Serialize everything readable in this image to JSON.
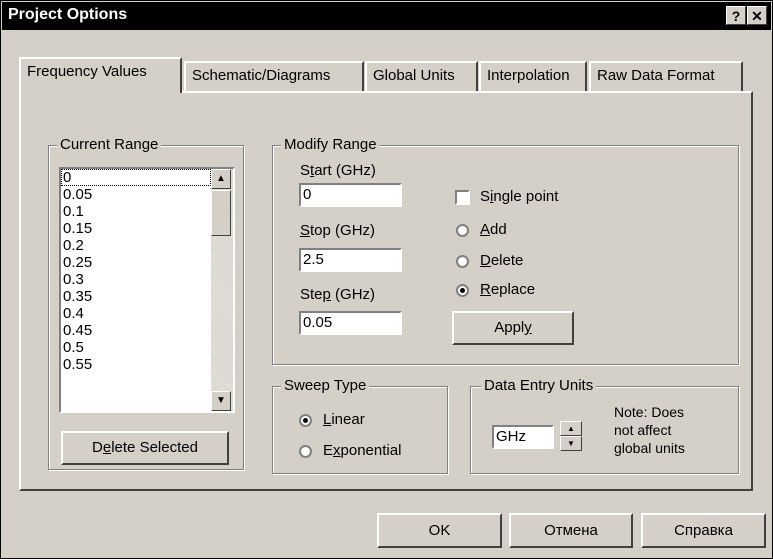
{
  "window": {
    "title": "Project Options",
    "help_button": "?",
    "close_button": "✕"
  },
  "tabs": [
    {
      "label": "Frequency Values",
      "active": true
    },
    {
      "label": "Schematic/Diagrams",
      "active": false
    },
    {
      "label": "Global Units",
      "active": false
    },
    {
      "label": "Interpolation",
      "active": false
    },
    {
      "label": "Raw Data Format",
      "active": false
    }
  ],
  "current_range": {
    "title": "Current Range",
    "items": [
      "0",
      "0.05",
      "0.1",
      "0.15",
      "0.2",
      "0.25",
      "0.3",
      "0.35",
      "0.4",
      "0.45",
      "0.5",
      "0.55"
    ],
    "selected": "0",
    "delete_button": {
      "pre": "D",
      "u": "e",
      "post": "lete Selected"
    }
  },
  "modify_range": {
    "title": "Modify Range",
    "start_label": {
      "pre": "S",
      "u": "t",
      "post": "art (GHz)"
    },
    "start_value": "0",
    "stop_label": {
      "pre": "",
      "u": "S",
      "post": "top (GHz)"
    },
    "stop_value": "2.5",
    "step_label": {
      "pre": "Ste",
      "u": "p",
      "post": " (GHz)"
    },
    "step_value": "0.05",
    "single_point": {
      "pre": "S",
      "u": "i",
      "post": "ngle point",
      "checked": false
    },
    "options": [
      {
        "pre": "",
        "u": "A",
        "post": "dd",
        "selected": false
      },
      {
        "pre": "",
        "u": "D",
        "post": "elete",
        "selected": false
      },
      {
        "pre": "",
        "u": "R",
        "post": "eplace",
        "selected": true
      }
    ],
    "apply_button": {
      "pre": "Appl",
      "u": "y",
      "post": ""
    }
  },
  "sweep_type": {
    "title": "Sweep Type",
    "options": [
      {
        "pre": "",
        "u": "L",
        "post": "inear",
        "selected": true
      },
      {
        "pre": "E",
        "u": "x",
        "post": "ponential",
        "selected": false
      }
    ]
  },
  "data_entry_units": {
    "title": "Data Entry Units",
    "value": "GHz",
    "note": [
      "Note: Does",
      "not affect",
      "global units"
    ]
  },
  "footer": {
    "ok": "OK",
    "cancel": "Отмена",
    "help": "Справка"
  }
}
